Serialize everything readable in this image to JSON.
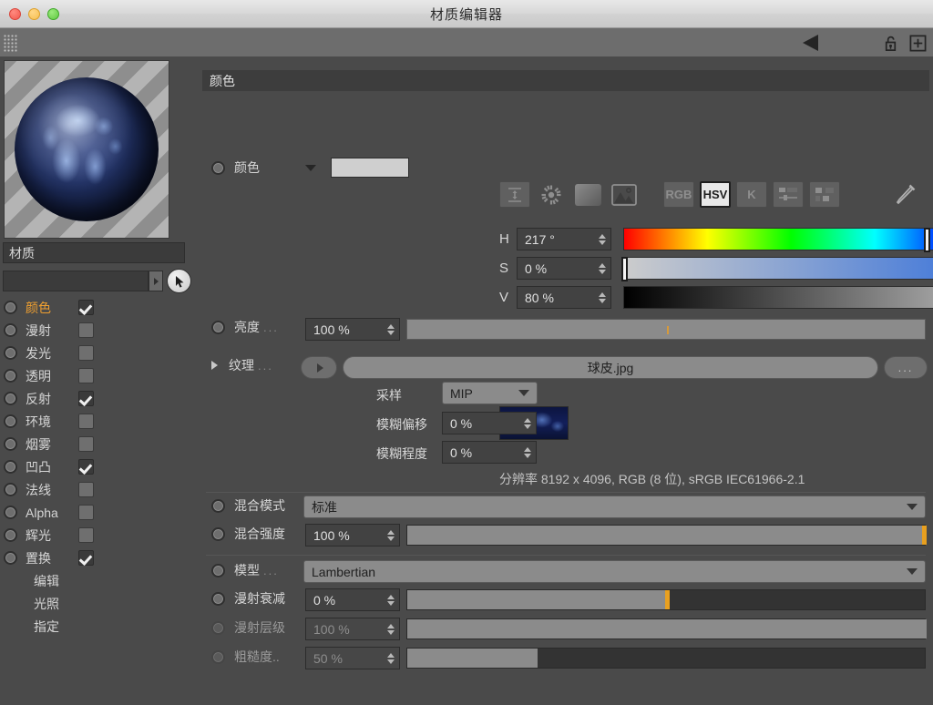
{
  "window": {
    "title": "材质编辑器",
    "traffic_lights": [
      "close-red",
      "minimize-yellow",
      "zoom-green"
    ]
  },
  "toolbar": {
    "grip": "drag-grip",
    "back_arrow": "back-triangle",
    "lock_icon": "unlocked-padlock",
    "add_icon": "plus-square"
  },
  "sidebar": {
    "material_name": "材质",
    "search_value": "",
    "cursor_button": "selection-arrow",
    "channels": [
      {
        "label": "颜色",
        "checked": true,
        "active": true
      },
      {
        "label": "漫射",
        "checked": false,
        "active": false
      },
      {
        "label": "发光",
        "checked": false,
        "active": false
      },
      {
        "label": "透明",
        "checked": false,
        "active": false
      },
      {
        "label": "反射",
        "checked": true,
        "active": false
      },
      {
        "label": "环境",
        "checked": false,
        "active": false
      },
      {
        "label": "烟雾",
        "checked": false,
        "active": false
      },
      {
        "label": "凹凸",
        "checked": true,
        "active": false
      },
      {
        "label": "法线",
        "checked": false,
        "active": false
      },
      {
        "label": "Alpha",
        "checked": false,
        "active": false
      },
      {
        "label": "辉光",
        "checked": false,
        "active": false
      },
      {
        "label": "置换",
        "checked": true,
        "active": false
      }
    ],
    "plain_items": [
      "编辑",
      "光照",
      "指定"
    ]
  },
  "main": {
    "section_title": "颜色",
    "color_row": {
      "label": "颜色",
      "swatch_hex": "#cfcfcf"
    },
    "color_modes": {
      "buttons": [
        "RGB",
        "HSV",
        "K"
      ],
      "selected": "HSV",
      "icons": [
        "range-icon",
        "color-wheel-icon",
        "gradient-icon",
        "image-icon",
        "mixer-icon",
        "swatches-icon",
        "eyedropper-icon"
      ]
    },
    "hsv": [
      {
        "letter": "H",
        "value": "217 °",
        "knob_pct": 60.2
      },
      {
        "letter": "S",
        "value": "0 %",
        "knob_pct": 0.0
      },
      {
        "letter": "V",
        "value": "80 %",
        "knob_pct": 79.5
      }
    ],
    "brightness": {
      "label": "亮度",
      "value": "100 %",
      "tick_pct": 50
    },
    "texture": {
      "label": "纹理",
      "filename": "球皮.jpg",
      "more_label": "..."
    },
    "sampling": {
      "label": "采样",
      "value": "MIP"
    },
    "blur_offset": {
      "label": "模糊偏移",
      "value": "0 %"
    },
    "blur_scale": {
      "label": "模糊程度",
      "value": "0 %"
    },
    "resolution": "分辨率 8192 x 4096, RGB (8 位), sRGB IEC61966-2.1",
    "blend_mode": {
      "label": "混合模式",
      "value": "标准"
    },
    "blend_strength": {
      "label": "混合强度",
      "value": "100 %",
      "fill_pct": 100
    },
    "model": {
      "label": "模型",
      "value": "Lambertian"
    },
    "diffuse_falloff": {
      "label": "漫射衰减",
      "value": "0 %",
      "fill_pct": 50
    },
    "diffuse_level": {
      "label": "漫射层级",
      "value": "100 %",
      "fill_pct": 100,
      "disabled": true
    },
    "roughness": {
      "label": "粗糙度..",
      "value": "50 %",
      "fill_pct": 25,
      "disabled": true
    }
  },
  "colors": {
    "accent_orange": "#f0a030",
    "panel_bg": "#4a4a4a",
    "field_bg": "#424242",
    "track_light": "#8b8b8b"
  }
}
